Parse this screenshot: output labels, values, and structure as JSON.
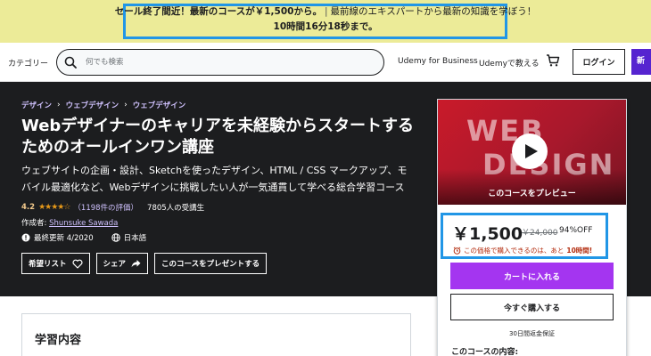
{
  "banner": {
    "highlight": "セール終了間近！最新のコースが￥1,500から。",
    "separator": "|",
    "message": "最前線のエキスパートから最新の知識を学ぼう！",
    "countdown": "10時間16分18秒まで。",
    "border_color": "#2196e6",
    "bg_color": "#eceb98"
  },
  "header": {
    "categories": "カテゴリー",
    "search_placeholder": "何でも検索",
    "business": "Udemy for Business",
    "teach": "Udemyで教える",
    "login": "ログイン",
    "signup": "新"
  },
  "course": {
    "breadcrumbs": [
      "デザイン",
      "ウェブデザイン",
      "ウェブデザイン"
    ],
    "title": "Webデザイナーのキャリアを未経験からスタートするためのオールインワン講座",
    "subtitle": "ウェブサイトの企画・設計、Sketchを使ったデザイン、HTML / CSS マークアップ、モバイル最適化など、Webデザインに挑戦したい人が一気通貫して学べる総合学習コース",
    "rating": "4.2",
    "stars": "★★★★☆",
    "rating_count": "（1198件の評価）",
    "students": "7805人の受講生",
    "author_label": "作成者: ",
    "author": "Shunsuke Sawada",
    "last_updated": "最終更新 4/2020",
    "language": "日本語",
    "wishlist": "希望リスト",
    "share": "シェア",
    "gift": "このコースをプレゼントする"
  },
  "card": {
    "preview_word1": "WEB",
    "preview_word2": "DESIGN",
    "preview_label": "このコースをプレビュー",
    "price": "￥1,500",
    "original_price": "￥24,000",
    "discount": "94%OFF",
    "urgency_prefix": "この価格で購入できるのは、あと",
    "urgency_time": "10時間!",
    "add_to_cart": "カートに入れる",
    "buy_now": "今すぐ購入する",
    "guarantee": "30日間返金保証",
    "includes": "このコースの内容:",
    "accent_color": "#a435f0"
  },
  "learn": {
    "title": "学習内容"
  }
}
